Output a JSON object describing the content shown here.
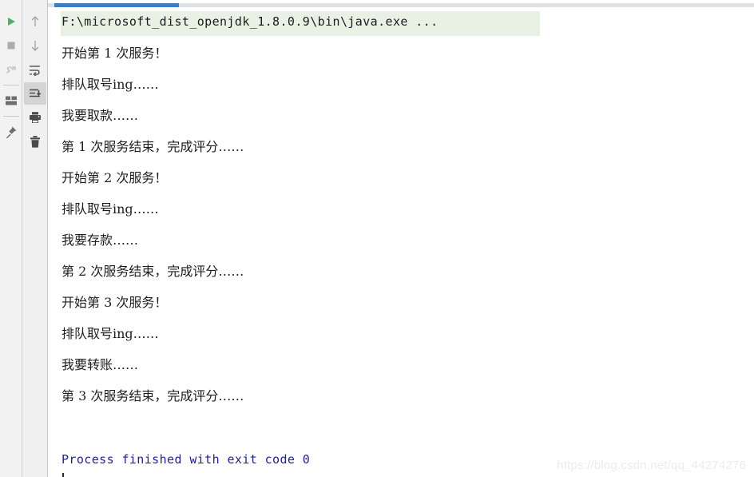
{
  "window": {
    "title": "Run Console Output"
  },
  "run_toolbar": {
    "name": "run-tool-window-actions",
    "buttons": [
      {
        "id": "rerun",
        "icon": "play-icon",
        "label": "Rerun",
        "enabled": true
      },
      {
        "id": "stop",
        "icon": "stop-square-icon",
        "label": "Stop",
        "enabled": true
      },
      {
        "id": "rerun-failed",
        "icon": "rerun-tests-icon",
        "label": "Rerun Failed Tests",
        "enabled": false
      },
      {
        "id": "layout",
        "icon": "layout-icon",
        "label": "Layout Settings",
        "enabled": true
      },
      {
        "id": "pin",
        "icon": "pin-icon",
        "label": "Pin Tab",
        "enabled": true
      }
    ]
  },
  "console_toolbar": {
    "name": "console-actions",
    "buttons": [
      {
        "id": "up",
        "icon": "arrow-up-icon",
        "label": "Up the Stack Trace",
        "selected": false
      },
      {
        "id": "down",
        "icon": "arrow-down-icon",
        "label": "Down the Stack Trace",
        "selected": false
      },
      {
        "id": "soft-wrap",
        "icon": "soft-wrap-icon",
        "label": "Use Soft Wraps",
        "selected": false
      },
      {
        "id": "scroll-end",
        "icon": "scroll-to-end-icon",
        "label": "Scroll to the End",
        "selected": true
      },
      {
        "id": "print",
        "icon": "printer-icon",
        "label": "Print",
        "selected": false
      },
      {
        "id": "clear-all",
        "icon": "trash-icon",
        "label": "Clear All",
        "selected": false
      }
    ]
  },
  "console": {
    "command_line": "F:\\microsoft_dist_openjdk_1.8.0.9\\bin\\java.exe ...",
    "command_highlight_color": "#e8f1e4",
    "exit_line": "Process finished with exit code 0",
    "exit_line_color": "#2020a0",
    "lines": [
      "开始第 1 次服务！",
      "排队取号ing……",
      "我要取款……",
      "第 1 次服务结束，完成评分……",
      "开始第 2 次服务！",
      "排队取号ing……",
      "我要存款……",
      "第 2 次服务结束，完成评分……",
      "开始第 3 次服务！",
      "排队取号ing……",
      "我要转账……",
      "第 3 次服务结束，完成评分……"
    ]
  },
  "tab": {
    "active_indicator_color": "#3c7ebf",
    "track_color": "#dfe1e5"
  },
  "watermark": {
    "text": "https://blog.csdn.net/qq_44274276"
  }
}
